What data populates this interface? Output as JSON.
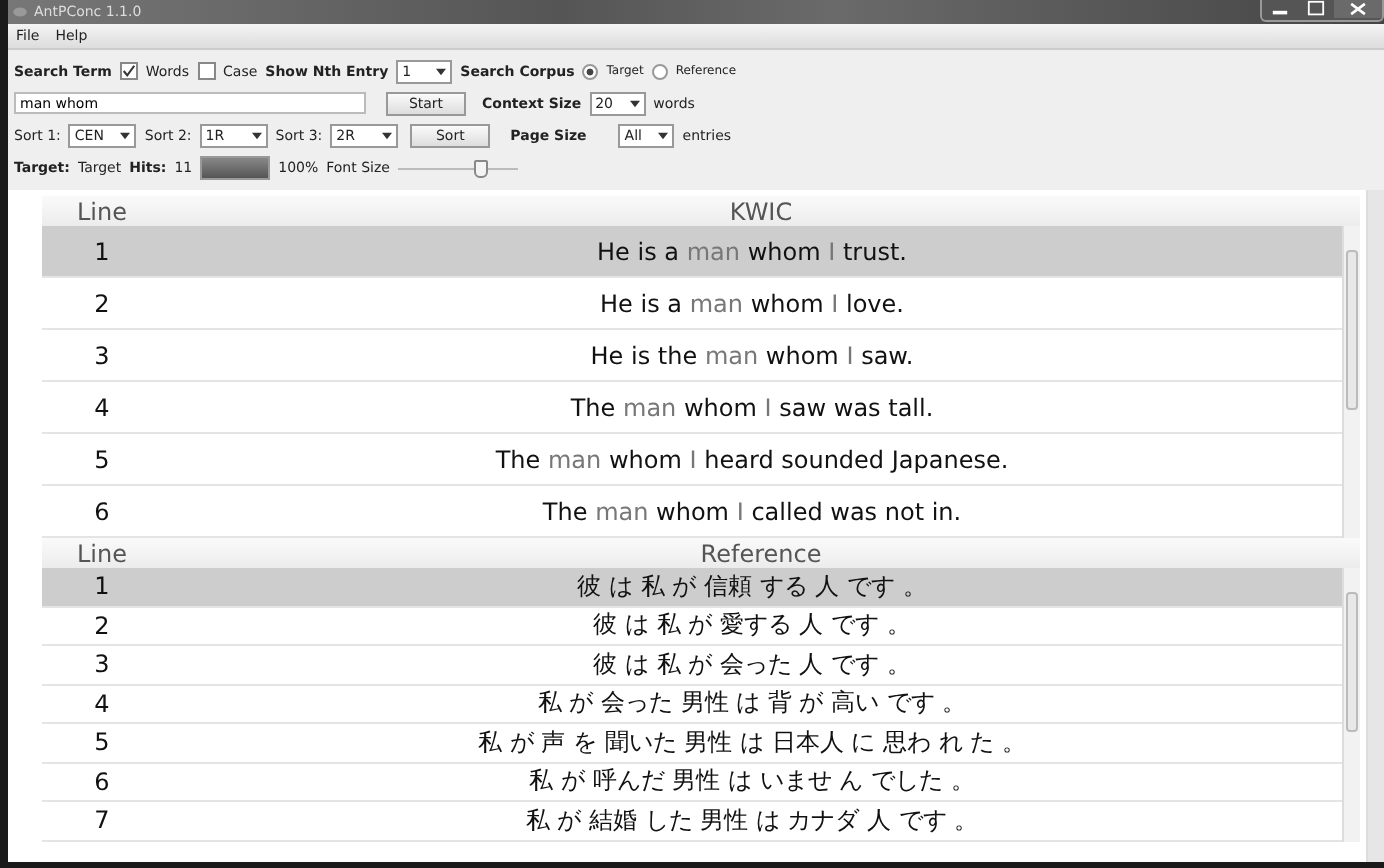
{
  "window": {
    "title": "AntPConc 1.1.0"
  },
  "menu": [
    "File",
    "Help"
  ],
  "search_row": {
    "search_term_label": "Search Term",
    "words": {
      "label": "Words",
      "checked": true
    },
    "case": {
      "label": "Case",
      "checked": false
    },
    "nth_label": "Show Nth Entry",
    "nth_value": "1",
    "corpus_label": "Search Corpus",
    "corpora": [
      {
        "label": "Target",
        "selected": true
      },
      {
        "label": "Reference",
        "selected": false
      }
    ]
  },
  "query_row": {
    "value": "man whom",
    "start": "Start",
    "context_label": "Context Size",
    "context_value": "20",
    "context_unit": "words"
  },
  "sort_row": {
    "sorts": [
      {
        "label": "Sort 1:",
        "value": "CEN"
      },
      {
        "label": "Sort 2:",
        "value": "1R"
      },
      {
        "label": "Sort 3:",
        "value": "2R"
      }
    ],
    "sort_button": "Sort",
    "page_size_label": "Page Size",
    "page_size_value": "All",
    "page_size_unit": "entries"
  },
  "status_row": {
    "target_label": "Target:",
    "corpus": "Target",
    "hits_label": "Hits:",
    "hits": "11",
    "progress": {
      "level": 1
    },
    "percent": "100%",
    "font_size_label": "Font Size",
    "font_size": {
      "level": 0.7
    }
  },
  "kwic_table": {
    "columns": [
      "Line",
      "KWIC"
    ],
    "rows": [
      {
        "line": "1",
        "selected": true,
        "parts": [
          {
            "text": "He is a",
            "hit": false
          },
          {
            "text": "man",
            "hit": true
          },
          {
            "text": "whom",
            "hit": false
          },
          {
            "text": "I",
            "hit": true
          },
          {
            "text": "trust.",
            "hit": false
          }
        ]
      },
      {
        "line": "2",
        "selected": false,
        "parts": [
          {
            "text": "He is a",
            "hit": false
          },
          {
            "text": "man",
            "hit": true
          },
          {
            "text": "whom",
            "hit": false
          },
          {
            "text": "I",
            "hit": true
          },
          {
            "text": "love.",
            "hit": false
          }
        ]
      },
      {
        "line": "3",
        "selected": false,
        "parts": [
          {
            "text": "He is the",
            "hit": false
          },
          {
            "text": "man",
            "hit": true
          },
          {
            "text": "whom",
            "hit": false
          },
          {
            "text": "I",
            "hit": true
          },
          {
            "text": "saw.",
            "hit": false
          }
        ]
      },
      {
        "line": "4",
        "selected": false,
        "parts": [
          {
            "text": "The",
            "hit": false
          },
          {
            "text": "man",
            "hit": true
          },
          {
            "text": "whom",
            "hit": false
          },
          {
            "text": "I",
            "hit": true
          },
          {
            "text": "saw was tall.",
            "hit": false
          }
        ]
      },
      {
        "line": "5",
        "selected": false,
        "parts": [
          {
            "text": "The",
            "hit": false
          },
          {
            "text": "man",
            "hit": true
          },
          {
            "text": "whom",
            "hit": false
          },
          {
            "text": "I",
            "hit": true
          },
          {
            "text": "heard sounded Japanese.",
            "hit": false
          }
        ]
      },
      {
        "line": "6",
        "selected": false,
        "parts": [
          {
            "text": "The",
            "hit": false
          },
          {
            "text": "man",
            "hit": true
          },
          {
            "text": "whom",
            "hit": false
          },
          {
            "text": "I",
            "hit": true
          },
          {
            "text": "called was not in.",
            "hit": false
          }
        ]
      }
    ]
  },
  "reference_table": {
    "columns": [
      "Line",
      "Reference"
    ],
    "rows": [
      {
        "line": "1",
        "selected": true,
        "text": "彼 は 私 が 信頼 する 人 です 。"
      },
      {
        "line": "2",
        "selected": false,
        "text": "彼 は 私 が 愛する 人 です 。"
      },
      {
        "line": "3",
        "selected": false,
        "text": "彼 は 私 が 会った 人 です 。"
      },
      {
        "line": "4",
        "selected": false,
        "text": "私 が 会った 男性 は 背 が 高い です 。"
      },
      {
        "line": "5",
        "selected": false,
        "text": "私 が 声 を 聞いた 男性 は 日本人 に 思わ れ た 。"
      },
      {
        "line": "6",
        "selected": false,
        "text": "私 が 呼んだ 男性 は いませ ん でした 。"
      },
      {
        "line": "7",
        "selected": false,
        "text": "私 が 結婚 した 男性 は カナダ 人 です 。"
      }
    ]
  }
}
